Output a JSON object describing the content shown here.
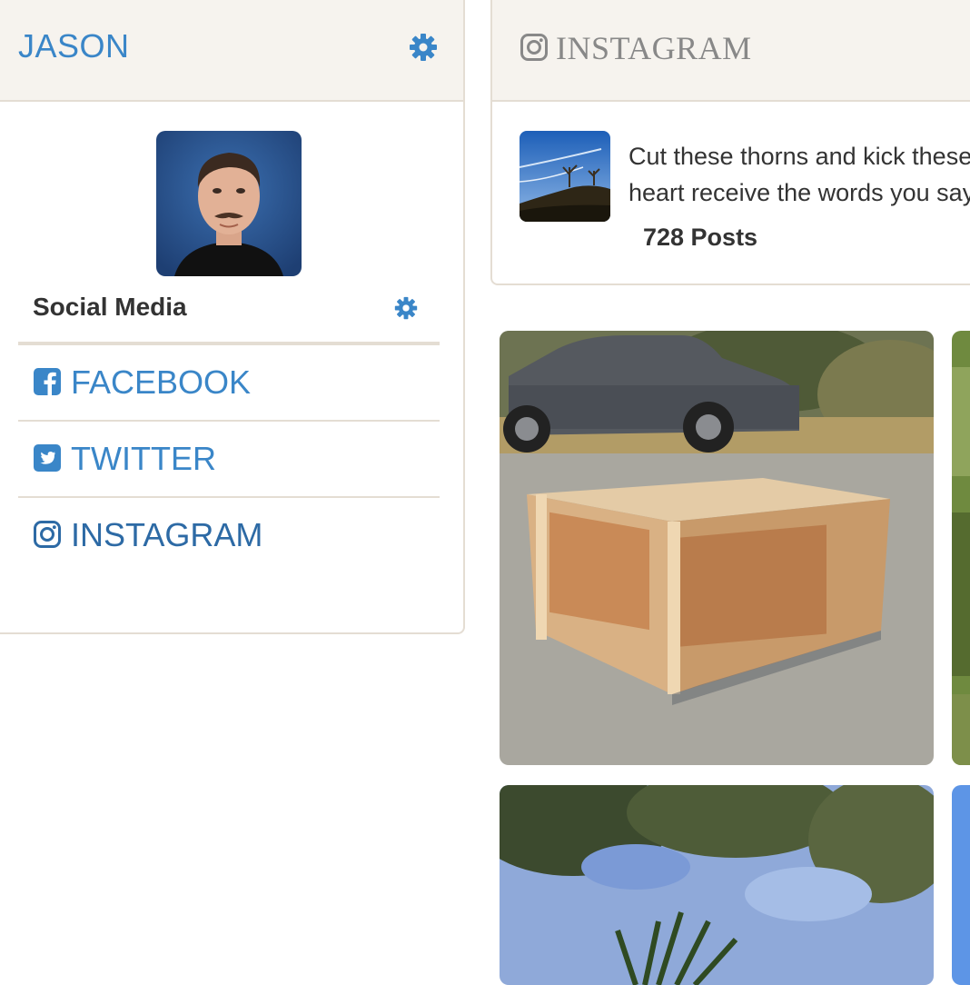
{
  "sidebar": {
    "title": "JASON",
    "section_label": "Social Media",
    "links": [
      {
        "label": "FACEBOOK",
        "icon": "facebook-square-icon"
      },
      {
        "label": "TWITTER",
        "icon": "twitter-square-icon"
      },
      {
        "label": "INSTAGRAM",
        "icon": "instagram-icon"
      }
    ]
  },
  "instagram": {
    "title": "INSTAGRAM",
    "bio": "Cut these thorns and kick these rocks / Let my heart receive the words you say",
    "bio_line1": "Cut these thorns and kick these",
    "bio_line2": "heart receive the words you say",
    "posts": "728 Posts"
  },
  "colors": {
    "accent": "#3a86c8",
    "header_bg": "#f6f3ee",
    "border": "#e4ddd3"
  }
}
